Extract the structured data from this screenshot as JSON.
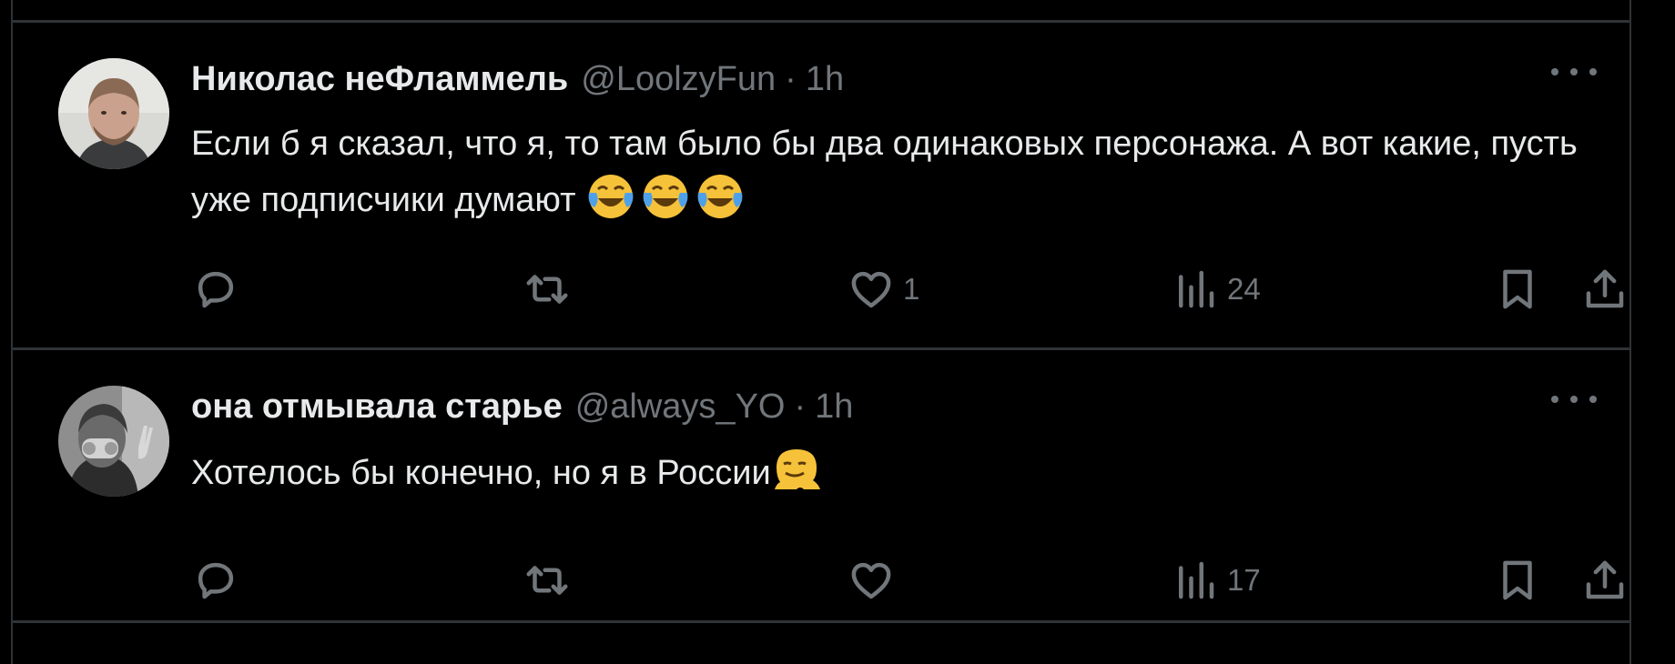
{
  "tweets": [
    {
      "name": "Николас неФламмель",
      "handle": "@LoolzyFun",
      "separator": "·",
      "time": "1h",
      "text": "Если б я сказал, что я, то там было бы два одинаковых персонажа. А вот какие, пусть уже подписчики думают",
      "emojis": [
        "face-with-tears-of-joy",
        "face-with-tears-of-joy",
        "face-with-tears-of-joy"
      ],
      "reply_count": "",
      "retweet_count": "",
      "like_count": "1",
      "view_count": "24"
    },
    {
      "name": "она отмывала старье",
      "handle": "@always_YO",
      "separator": "·",
      "time": "1h",
      "text": "Хотелось бы конечно, но я в России",
      "emojis": [
        "melting-face"
      ],
      "reply_count": "",
      "retweet_count": "",
      "like_count": "",
      "view_count": "17"
    }
  ],
  "colors": {
    "background": "#000000",
    "text": "#e7e9ea",
    "muted": "#71767b",
    "border": "#2f3336"
  }
}
